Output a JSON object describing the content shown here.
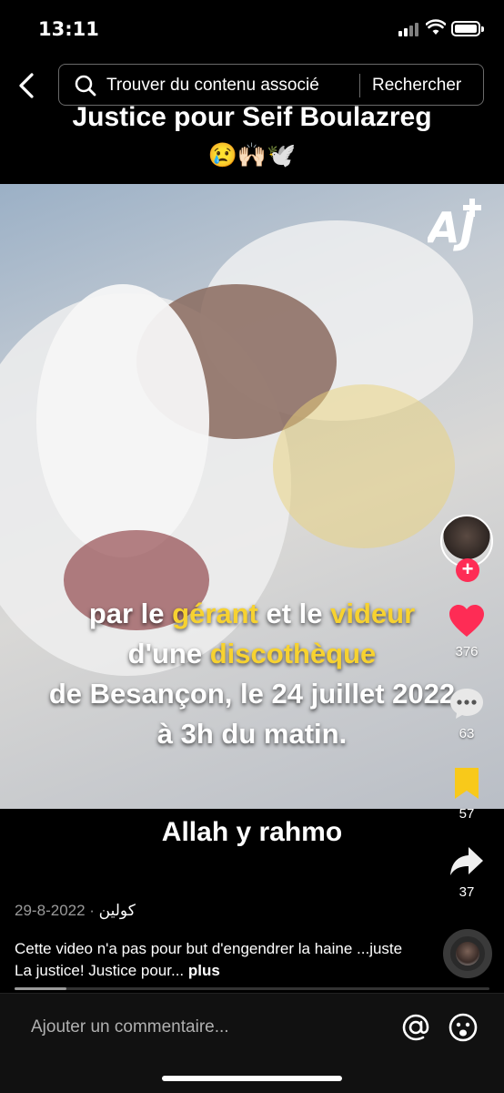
{
  "status_bar": {
    "time": "13:11"
  },
  "header": {
    "search_placeholder": "Trouver du contenu associé",
    "search_button": "Rechercher"
  },
  "video": {
    "title": "Justice pour Seif Boulazreg",
    "title_emoji": "😢🙌🏻🕊️",
    "overlay": {
      "line1_a": "par le ",
      "line1_hl1": "gérant",
      "line1_b": " et le ",
      "line1_hl2": "videur",
      "line2_a": "d'une ",
      "line2_hl": "discothèque",
      "line3": "de Besançon, le 24 juillet 2022",
      "line4": "à 3h du matin."
    },
    "bottom_title": "Allah y rahmo"
  },
  "actions": {
    "likes": "376",
    "comments": "63",
    "saves": "57",
    "shares": "37"
  },
  "post": {
    "author": "كولين",
    "separator": " · ",
    "date": "2022-8-29",
    "description": "Cette video n'a pas pour but d'engendrer la haine ...juste La justice! Justice pour... ",
    "more": "plus",
    "progress": 0.11
  },
  "comment_bar": {
    "placeholder": "Ajouter un commentaire..."
  },
  "colors": {
    "highlight": "#f7d230",
    "like": "#fe2c55",
    "save": "#f8c91a"
  }
}
